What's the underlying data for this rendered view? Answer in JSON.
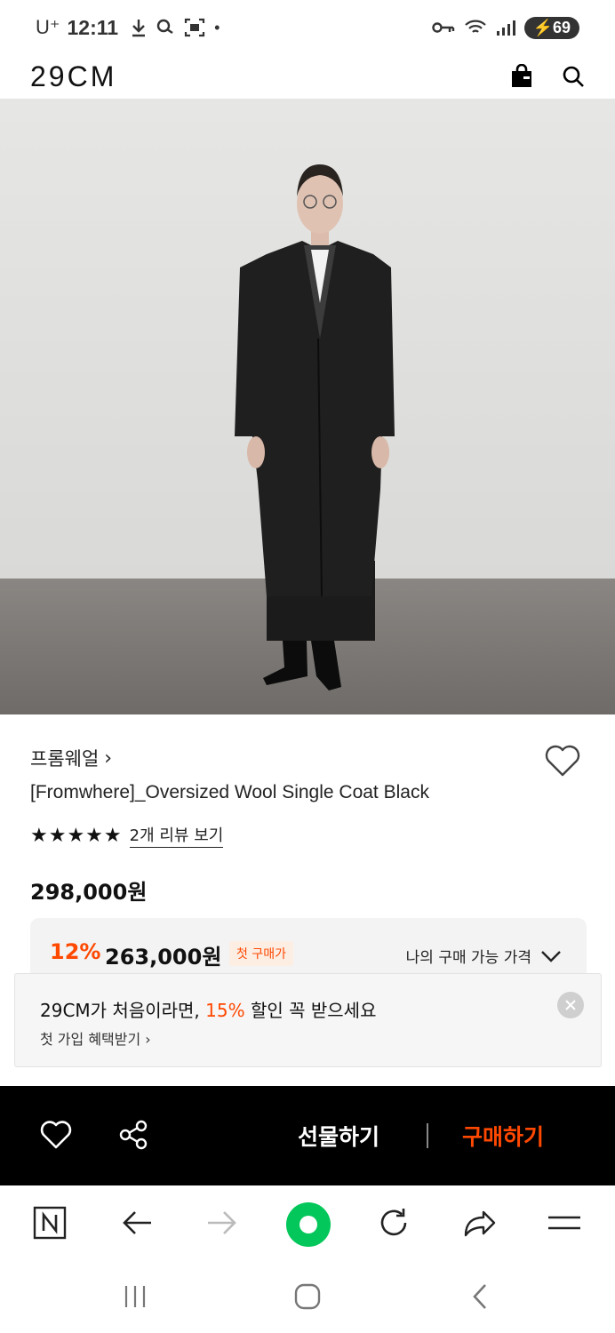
{
  "status_bar": {
    "carrier": "U⁺",
    "time": "12:11",
    "dot": "•",
    "battery": "69",
    "icons": [
      "download-icon",
      "call-icon",
      "screenshot-icon",
      "key-icon",
      "wifi-icon",
      "signal-icon",
      "battery-icon"
    ]
  },
  "header": {
    "logo": "29CM",
    "icons": [
      "shopping-bag-icon",
      "search-icon"
    ]
  },
  "product": {
    "image_alt": "Model wearing black oversized wool single coat",
    "brand": "프롬웨얼",
    "brand_chevron": "›",
    "title": "[Fromwhere]_Oversized Wool Single Coat Black",
    "stars": "★★★★★",
    "reviews_link": "2개 리뷰 보기",
    "price": "298,000원",
    "discount_rate": "12%",
    "discount_price": "263,000원",
    "first_purchase_badge": "첫 구매가",
    "my_price_label": "나의 구매 가능 가격"
  },
  "promo": {
    "text_before": "29CM가 처음이라면, ",
    "highlight": "15%",
    "text_after": " 할인 꼭 받으세요",
    "link": "첫 가입 혜택받기 ›"
  },
  "buy_bar": {
    "gift_label": "선물하기",
    "buy_label": "구매하기",
    "icons": [
      "heart-icon",
      "share-icon"
    ]
  },
  "browser_toolbar": {
    "icons": [
      "naver-home-icon",
      "back-arrow-icon",
      "forward-arrow-icon",
      "naver-green-button-icon",
      "refresh-icon",
      "share-arrow-icon",
      "menu-icon"
    ]
  },
  "colors": {
    "accent": "#ff4800",
    "buy_bar_bg": "#000000",
    "naver_green": "#03c75a"
  }
}
